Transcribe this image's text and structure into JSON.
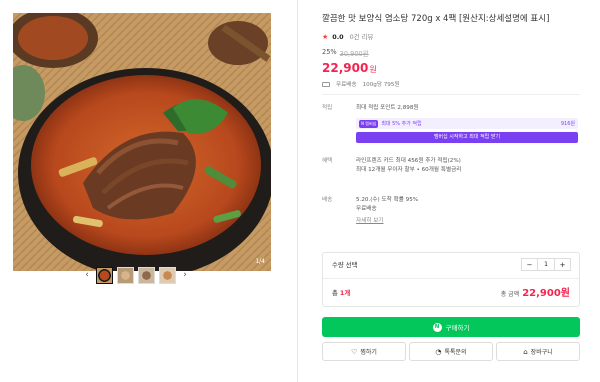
{
  "gallery": {
    "counter": "1/4",
    "prev_icon": "‹",
    "next_icon": "›",
    "thumbnail_count": 4
  },
  "product": {
    "title": "깔끔한 맛 보양식 염소탕 720g x 4팩 [원산지:상세설명에 표시]",
    "rating": "0.0",
    "reviews": "0건 리뷰",
    "discount_rate": "25%",
    "original_price": "30,900원",
    "price": "22,900",
    "price_unit": "원",
    "shipping": "무료배송",
    "unit_price": "100g당 795원"
  },
  "points": {
    "label": "적립",
    "max_points": "최대 적립 포인트 2,898원",
    "promo_badge": "N 멤버십",
    "promo_text": "최대 5% 추가 적립",
    "promo_amount": "916원",
    "promo_button": "멤버십 시작하고 최대 적립 받기"
  },
  "benefits": {
    "label": "혜택",
    "line1": "라인프렌즈 카드 최대 456원 추가 적립(2%)",
    "line2": "최대 12개월 무이자 할부 • 60개월 특별금리"
  },
  "delivery": {
    "label": "배송",
    "line1": "5.20.(수) 도착 확률 95%",
    "line2": "무료배송",
    "detail_link": "자세히 보기"
  },
  "order": {
    "qty_label": "수량 선택",
    "qty_value": "1",
    "minus": "−",
    "plus": "+",
    "total_count_prefix": "총 ",
    "total_count": "1개",
    "total_amount_label": "총 금액",
    "total_amount": "22,900원"
  },
  "buttons": {
    "buy": "구매하기",
    "buy_icon": "N",
    "wish": "찜하기",
    "talk": "톡톡문의",
    "cart": "장바구니"
  },
  "colors": {
    "accent_red": "#f4234f",
    "naver_green": "#03c75a",
    "membership_purple": "#7b3ff2"
  }
}
